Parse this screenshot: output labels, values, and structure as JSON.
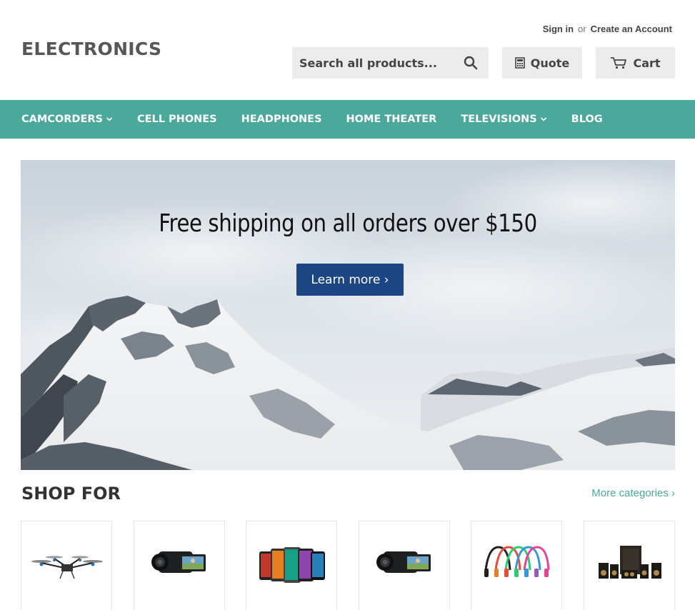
{
  "header": {
    "logo": "ELECTRONICS",
    "sign_in": "Sign in",
    "or": "or",
    "create_account": "Create an Account",
    "search_placeholder": "Search all products...",
    "quote_label": "Quote",
    "cart_label": "Cart"
  },
  "nav": {
    "items": [
      {
        "label": "CAMCORDERS",
        "has_dropdown": true
      },
      {
        "label": "CELL PHONES",
        "has_dropdown": false
      },
      {
        "label": "HEADPHONES",
        "has_dropdown": false
      },
      {
        "label": "HOME THEATER",
        "has_dropdown": false
      },
      {
        "label": "TELEVISIONS",
        "has_dropdown": true
      },
      {
        "label": "BLOG",
        "has_dropdown": false
      }
    ]
  },
  "hero": {
    "headline": "Free shipping on all orders over $150",
    "cta_label": "Learn more ›"
  },
  "shop_for": {
    "title": "SHOP FOR",
    "more_link": "More categories ›",
    "categories": [
      {
        "icon": "drone-icon"
      },
      {
        "icon": "camcorder-icon"
      },
      {
        "icon": "cell-phones-icon"
      },
      {
        "icon": "camcorder-icon"
      },
      {
        "icon": "headphones-icon"
      },
      {
        "icon": "speakers-icon"
      }
    ]
  },
  "colors": {
    "nav_bg": "#4aa99a",
    "cta_bg": "#1c4584",
    "link": "#4aa99a"
  }
}
